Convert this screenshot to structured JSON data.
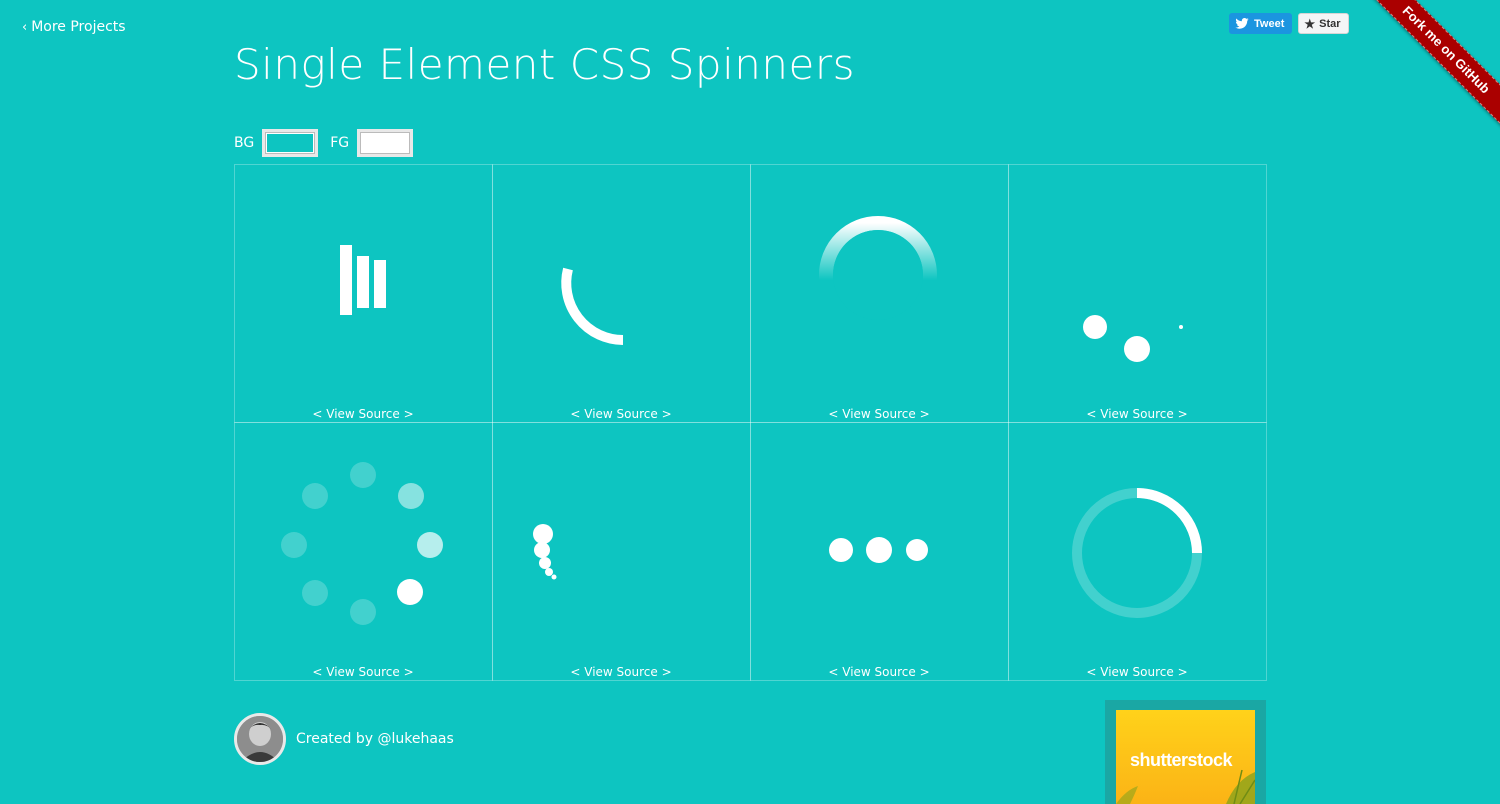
{
  "nav": {
    "more_projects": "More Projects"
  },
  "title": "Single Element CSS Spinners",
  "social": {
    "tweet": "Tweet",
    "star": "Star",
    "ribbon": "Fork me on GitHub"
  },
  "colors": {
    "bg_label": "BG",
    "fg_label": "FG",
    "bg_value": "#0dc5c1",
    "fg_value": "#ffffff"
  },
  "spinners": [
    {
      "name": "bars",
      "view_source": "< View Source >"
    },
    {
      "name": "arc",
      "view_source": "< View Source >"
    },
    {
      "name": "gradient-ring",
      "view_source": "< View Source >"
    },
    {
      "name": "orbit-dots",
      "view_source": "< View Source >"
    },
    {
      "name": "dot-circle",
      "view_source": "< View Source >"
    },
    {
      "name": "dot-trail",
      "view_source": "< View Source >"
    },
    {
      "name": "three-dots",
      "view_source": "< View Source >"
    },
    {
      "name": "ring-arc",
      "view_source": "< View Source >"
    }
  ],
  "footer": {
    "credit": "Created by @lukehaas"
  },
  "ad": {
    "brand": "shutterstock"
  }
}
